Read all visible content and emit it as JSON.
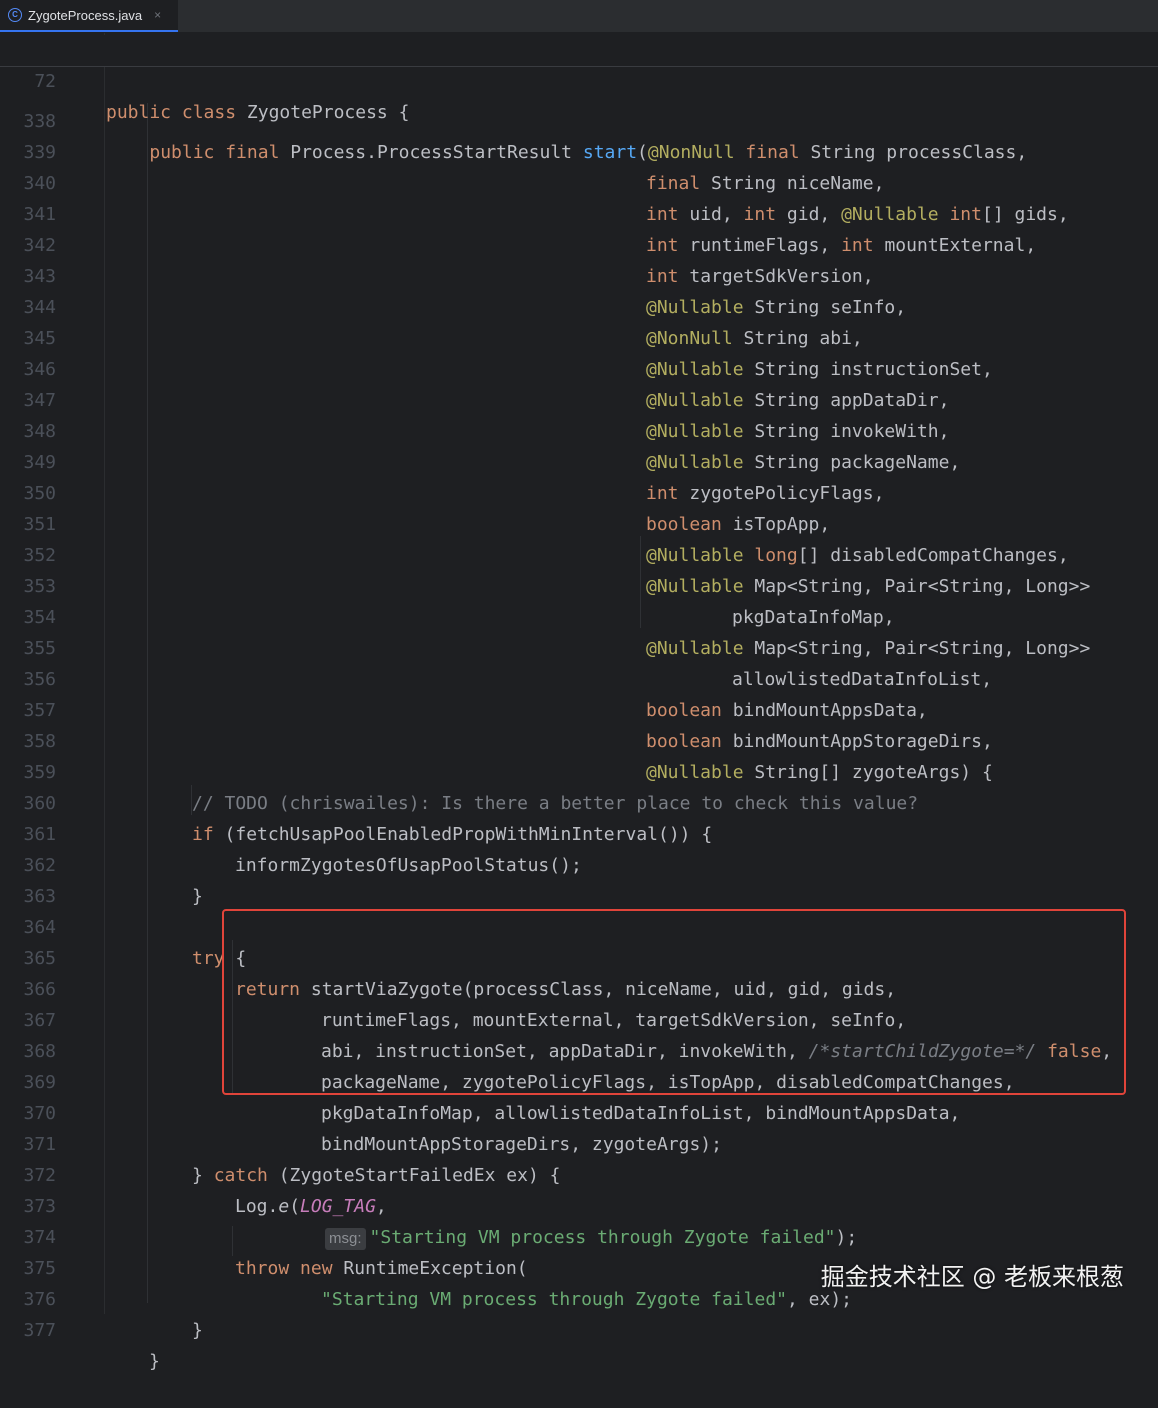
{
  "tab": {
    "title": "ZygoteProcess.java",
    "close": "×"
  },
  "sticky": {
    "ln": "72",
    "code": "public class ZygoteProcess {"
  },
  "lines": {
    "l338": {
      "ln": "338",
      "t1": "public final ",
      "t2": "Process.ProcessStartResult ",
      "t3": "start",
      "t4": "(",
      "t5": "@NonNull",
      "t6": " final ",
      "t7": "String processClass,"
    },
    "l339": {
      "ln": "339",
      "t1": "final ",
      "t2": "String niceName,"
    },
    "l340": {
      "ln": "340",
      "t1": "int ",
      "t2": "uid, ",
      "t3": "int ",
      "t4": "gid, ",
      "t5": "@Nullable ",
      "t6": "int",
      "t7": "[] gids,"
    },
    "l341": {
      "ln": "341",
      "t1": "int ",
      "t2": "runtimeFlags, ",
      "t3": "int ",
      "t4": "mountExternal,"
    },
    "l342": {
      "ln": "342",
      "t1": "int ",
      "t2": "targetSdkVersion,"
    },
    "l343": {
      "ln": "343",
      "t1": "@Nullable ",
      "t2": "String seInfo,"
    },
    "l344": {
      "ln": "344",
      "t1": "@NonNull ",
      "t2": "String abi,"
    },
    "l345": {
      "ln": "345",
      "t1": "@Nullable ",
      "t2": "String instructionSet,"
    },
    "l346": {
      "ln": "346",
      "t1": "@Nullable ",
      "t2": "String appDataDir,"
    },
    "l347": {
      "ln": "347",
      "t1": "@Nullable ",
      "t2": "String invokeWith,"
    },
    "l348": {
      "ln": "348",
      "t1": "@Nullable ",
      "t2": "String packageName,"
    },
    "l349": {
      "ln": "349",
      "t1": "int ",
      "t2": "zygotePolicyFlags,"
    },
    "l350": {
      "ln": "350",
      "t1": "boolean ",
      "t2": "isTopApp,"
    },
    "l351": {
      "ln": "351",
      "t1": "@Nullable ",
      "t2": "long",
      "t3": "[] disabledCompatChanges,"
    },
    "l352": {
      "ln": "352",
      "t1": "@Nullable ",
      "t2": "Map<String, Pair<String, Long>>"
    },
    "l353": {
      "ln": "353",
      "t1": "pkgDataInfoMap,"
    },
    "l354": {
      "ln": "354",
      "t1": "@Nullable ",
      "t2": "Map<String, Pair<String, Long>>"
    },
    "l355": {
      "ln": "355",
      "t1": "allowlistedDataInfoList,"
    },
    "l356": {
      "ln": "356",
      "t1": "boolean ",
      "t2": "bindMountAppsData,"
    },
    "l357": {
      "ln": "357",
      "t1": "boolean ",
      "t2": "bindMountAppStorageDirs,"
    },
    "l358": {
      "ln": "358",
      "t1": "@Nullable ",
      "t2": "String[] zygoteArgs) {"
    },
    "l359": {
      "ln": "359",
      "t1": "// TODO (chriswailes): Is there a better place to check this value?"
    },
    "l360": {
      "ln": "360",
      "t1": "if ",
      "t2": "(fetchUsapPoolEnabledPropWithMinInterval()) {"
    },
    "l361": {
      "ln": "361",
      "t1": "informZygotesOfUsapPoolStatus();"
    },
    "l362": {
      "ln": "362",
      "t1": "}"
    },
    "l363": {
      "ln": "363"
    },
    "l364": {
      "ln": "364",
      "t1": "try ",
      "t2": "{"
    },
    "l365": {
      "ln": "365",
      "t1": "return ",
      "t2": "startViaZygote(processClass, niceName, uid, gid, gids,"
    },
    "l366": {
      "ln": "366",
      "t1": "runtimeFlags, mountExternal, targetSdkVersion, seInfo,"
    },
    "l367": {
      "ln": "367",
      "t1": "abi, instructionSet, appDataDir, invokeWith, ",
      "t2": "/*startChildZygote=*/ ",
      "t3": "false",
      "t4": ","
    },
    "l368": {
      "ln": "368",
      "t1": "packageName, zygotePolicyFlags, isTopApp, disabledCompatChanges,"
    },
    "l369": {
      "ln": "369",
      "t1": "pkgDataInfoMap, allowlistedDataInfoList, bindMountAppsData,"
    },
    "l370": {
      "ln": "370",
      "t1": "bindMountAppStorageDirs, zygoteArgs);"
    },
    "l371": {
      "ln": "371",
      "t1": "} ",
      "t2": "catch ",
      "t3": "(ZygoteStartFailedEx ex) {"
    },
    "l372": {
      "ln": "372",
      "t1": "Log.",
      "t2": "e",
      "t3": "(",
      "t4": "LOG_TAG",
      "t5": ","
    },
    "l373": {
      "ln": "373",
      "hint": "msg:",
      "t1": "\"Starting VM process through Zygote failed\"",
      "t2": ");"
    },
    "l374": {
      "ln": "374",
      "t1": "throw ",
      "t2": "new ",
      "t3": "RuntimeException("
    },
    "l375": {
      "ln": "375",
      "t1": "\"Starting VM process through Zygote failed\"",
      "t2": ", ex);"
    },
    "l376": {
      "ln": "376",
      "t1": "}"
    },
    "l377": {
      "ln": "377",
      "t1": "}"
    }
  },
  "watermark": "掘金技术社区 @ 老板来根葱"
}
